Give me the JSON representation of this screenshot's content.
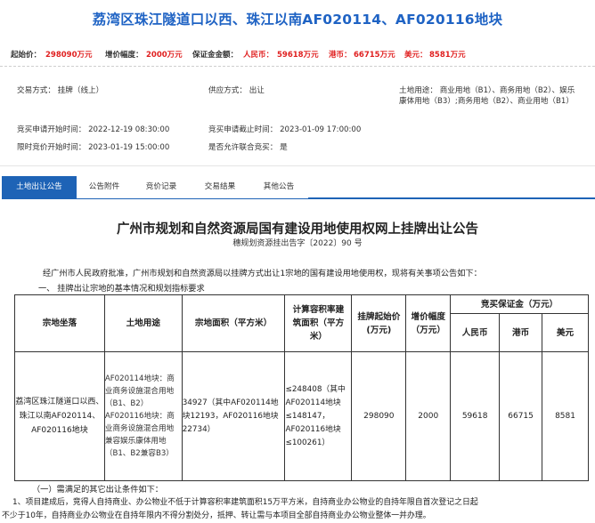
{
  "title": "荔湾区珠江隧道口以西、珠江以南AF020114、AF020116地块",
  "price_bar": {
    "start_label": "起始价：",
    "start_value": "298090万元",
    "increment_label": "增价幅度：",
    "increment_value": "2000万元",
    "deposit_label": "保证金金额：",
    "rmb_label": "人民币：",
    "rmb_value": "59618万元",
    "hkd_label": "港币：",
    "hkd_value": "66715万元",
    "usd_label": "美元：",
    "usd_value": "8581万元"
  },
  "info": {
    "trade_method": "交易方式：  挂牌（线上）",
    "supply_method": "供应方式：  出让",
    "land_use": "土地用途：  商业用地（B1）、商务用地（B2）、娱乐康体用地（B3）;商务用地（B2）、商业用地（B1）",
    "apply_start": "竞买申请开始时间：  2022-12-19 08:30:00",
    "apply_end": "竞买申请截止时间：  2023-01-09 17:00:00",
    "bid_start": "限时竞价开始时间：  2023-01-19 15:00:00",
    "joint_bid": "是否允许联合竞买：  是"
  },
  "tabs": [
    "土地出让公告",
    "公告附件",
    "竞价记录",
    "交易结果",
    "其他公告"
  ],
  "announcement": {
    "title": "广州市规划和自然资源局国有建设用地使用权网上挂牌出让公告",
    "doc_no": "穗规划资源挂出告字〔2022〕90 号",
    "intro": "经广州市人民政府批准，广州市规划和自然资源局以挂牌方式出让1宗地的国有建设用地使用权，现将有关事项公告如下：",
    "section1": "一、 挂牌出让宗地的基本情况和规划指标要求"
  },
  "table": {
    "headers": {
      "location": "宗地坐落",
      "use": "土地用途",
      "area": "宗地面积（平方米）",
      "far": "计算容积率建筑面积（平方米）",
      "start_price": "挂牌起始价(万元)",
      "increment": "增价幅度（万元）",
      "deposit": "竞买保证金（万元）",
      "rmb": "人民币",
      "hkd": "港币",
      "usd": "美元"
    },
    "row": {
      "location": "荔湾区珠江隧道口以西、珠江以南AF020114、AF020116地块",
      "use": "AF020114地块：商业商务设施混合用地（B1、B2）AF020116地块：商业商务设施混合用地兼容娱乐康体用地（B1、B2兼容B3）",
      "area": "34927（其中AF020114地块12193，AF020116地块22734）",
      "far": "≤248408（其中AF020114地块≤148147，AF020116地块≤100261）",
      "start_price": "298090",
      "increment": "2000",
      "rmb": "59618",
      "hkd": "66715",
      "usd": "8581"
    }
  },
  "conditions": {
    "heading": "（一）需满足的其它出让条件如下：",
    "line1": "1、项目建成后，竞得人自持商业、办公物业不低于计算容积率建筑面积15万平方米，自持商业办公物业的自持年限自首次登记之日起",
    "line2": "不少于10年，自持商业办公物业在自持年限内不得分割处分，抵押、转让需与本项目全部自持商业办公物业整体一并办理。"
  }
}
